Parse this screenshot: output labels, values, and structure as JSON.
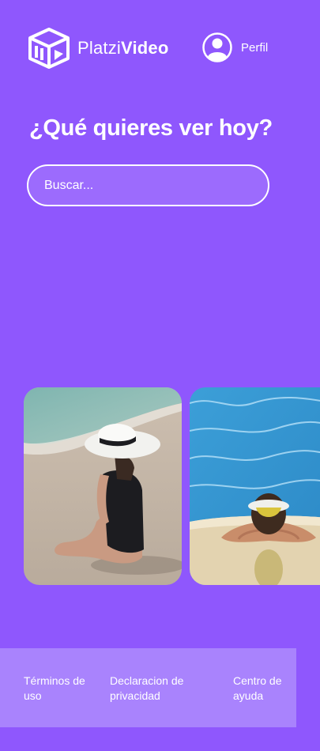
{
  "header": {
    "logo_prefix": "Platzi",
    "logo_suffix": "Video",
    "logo_icon": "cube-play-icon",
    "profile_label": "Perfil",
    "profile_icon": "user-avatar-icon"
  },
  "main": {
    "title": "¿Qué quieres ver hoy?",
    "search_placeholder": "Buscar..."
  },
  "carousel": {
    "items": [
      {
        "image": "woman-in-hat-on-beach"
      },
      {
        "image": "woman-in-visor-at-pool"
      }
    ]
  },
  "footer": {
    "links": [
      "Términos de uso",
      "Declaracion de privacidad",
      "Centro de ayuda"
    ]
  },
  "colors": {
    "background": "#8f57fd",
    "footer": "#a983fd",
    "text": "#ffffff"
  }
}
